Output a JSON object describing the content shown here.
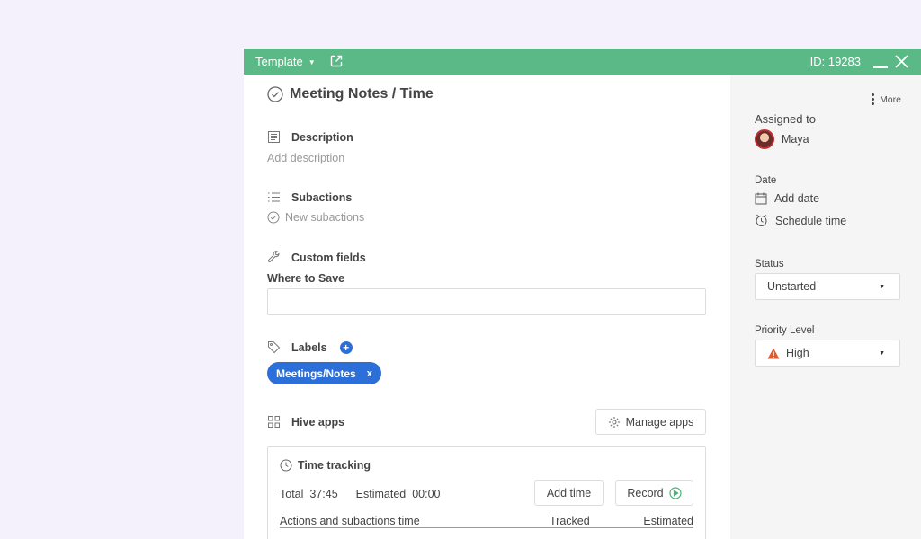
{
  "header": {
    "template_label": "Template",
    "id_label": "ID: 19283"
  },
  "action": {
    "title": "Meeting Notes / Time"
  },
  "description": {
    "heading": "Description",
    "placeholder": "Add description"
  },
  "subactions": {
    "heading": "Subactions",
    "placeholder": "New subactions"
  },
  "custom_fields": {
    "heading": "Custom fields",
    "field_label": "Where to Save",
    "field_value": ""
  },
  "labels": {
    "heading": "Labels",
    "add_symbol": "+",
    "chips": [
      {
        "text": "Meetings/Notes",
        "remove": "x"
      }
    ]
  },
  "hive_apps": {
    "heading": "Hive apps",
    "manage_button": "Manage apps"
  },
  "time_tracking": {
    "heading": "Time tracking",
    "total_label": "Total",
    "total_value": "37:45",
    "estimated_label": "Estimated",
    "estimated_value": "00:00",
    "add_time_button": "Add time",
    "record_button": "Record",
    "col_actions": "Actions and subactions time",
    "col_tracked": "Tracked",
    "col_estimated": "Estimated"
  },
  "sidebar": {
    "more_label": "More",
    "assigned_label": "Assigned to",
    "assignee": "Maya",
    "date_label": "Date",
    "add_date": "Add date",
    "schedule_time": "Schedule time",
    "status_label": "Status",
    "status_value": "Unstarted",
    "priority_label": "Priority Level",
    "priority_value": "High"
  },
  "colors": {
    "header_green": "#5bb887",
    "accent_blue": "#2d6fd8",
    "record_green": "#4caf7a",
    "priority_high": "#e05a2b",
    "page_bg": "#f5f1fc"
  }
}
